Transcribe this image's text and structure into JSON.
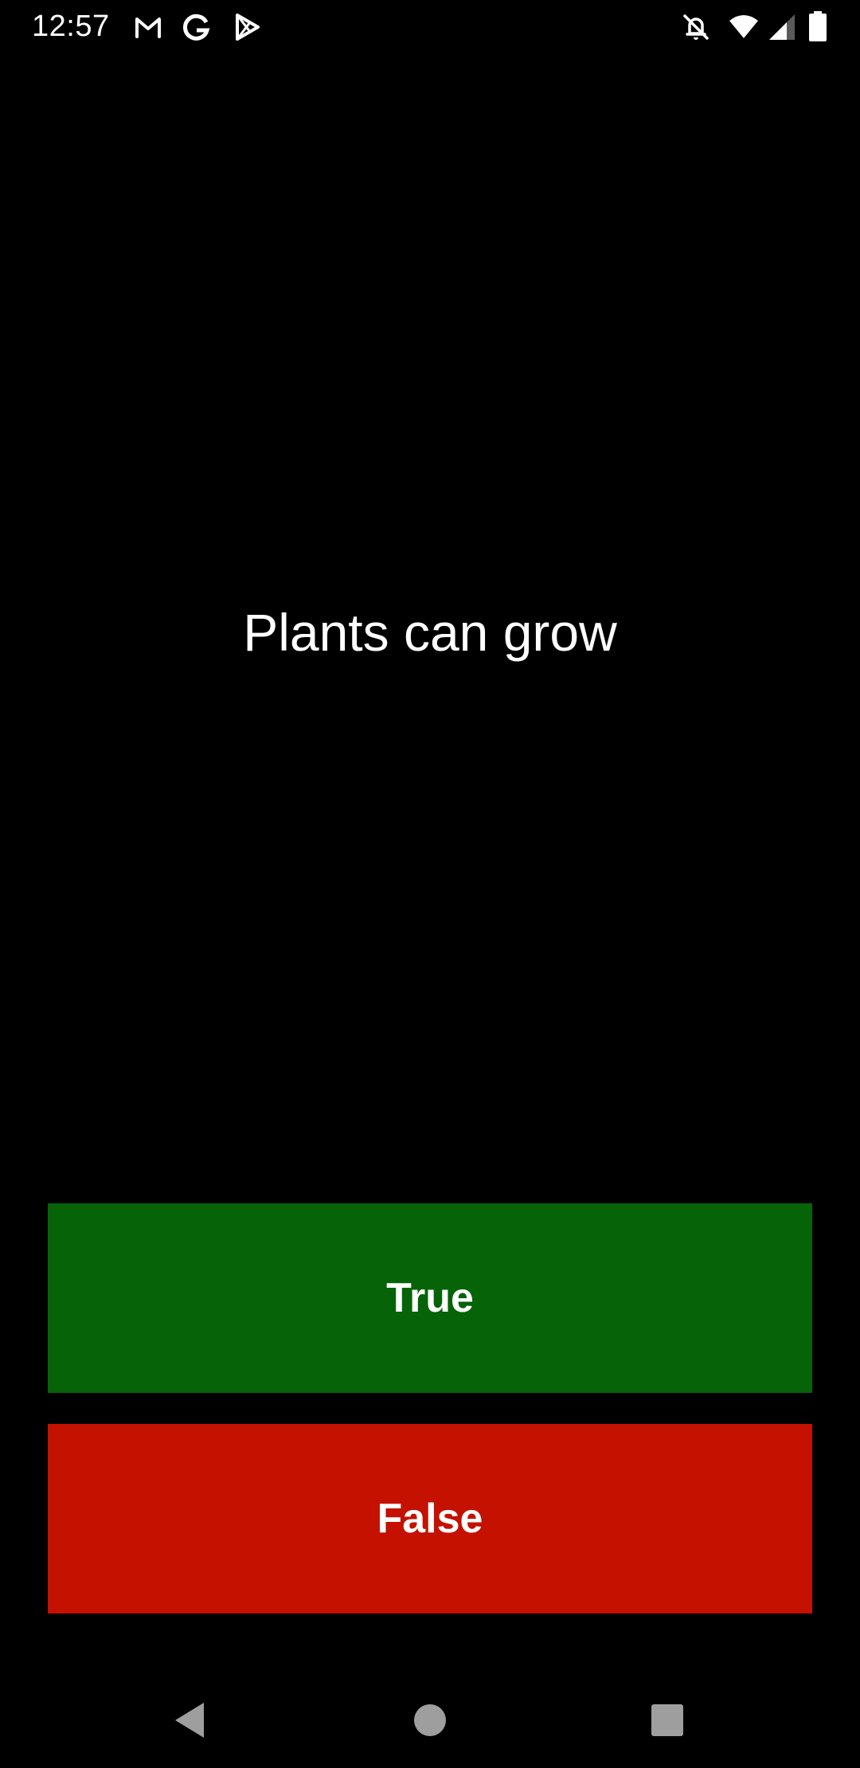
{
  "status_bar": {
    "time": "12:57",
    "left_icons": [
      "gmail-icon",
      "google-icon",
      "play-store-icon"
    ],
    "right_icons": [
      "notifications-off-icon",
      "wifi-icon",
      "cell-signal-icon",
      "battery-icon"
    ]
  },
  "question": {
    "text": "Plants can grow"
  },
  "answers": {
    "true_label": "True",
    "false_label": "False"
  },
  "colors": {
    "background": "#000000",
    "true_button": "#066308",
    "false_button": "#c41100",
    "text": "#ffffff",
    "nav_icons": "#9e9e9e"
  },
  "nav_bar": {
    "buttons": [
      "back-icon",
      "home-icon",
      "recents-icon"
    ]
  }
}
